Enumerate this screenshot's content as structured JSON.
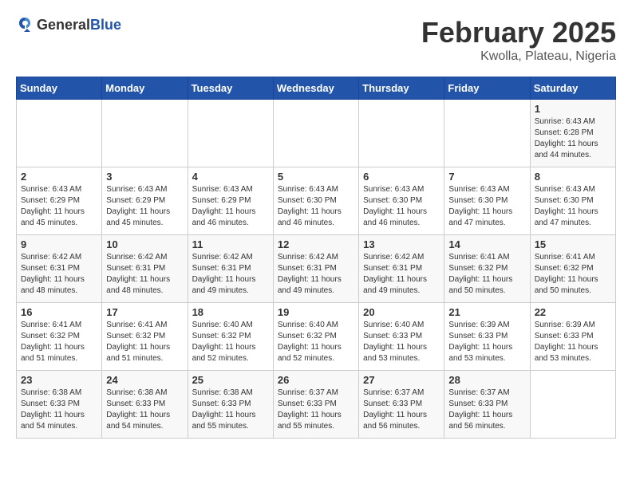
{
  "header": {
    "logo_general": "General",
    "logo_blue": "Blue",
    "title": "February 2025",
    "subtitle": "Kwolla, Plateau, Nigeria"
  },
  "weekdays": [
    "Sunday",
    "Monday",
    "Tuesday",
    "Wednesday",
    "Thursday",
    "Friday",
    "Saturday"
  ],
  "weeks": [
    [
      {
        "day": "",
        "info": ""
      },
      {
        "day": "",
        "info": ""
      },
      {
        "day": "",
        "info": ""
      },
      {
        "day": "",
        "info": ""
      },
      {
        "day": "",
        "info": ""
      },
      {
        "day": "",
        "info": ""
      },
      {
        "day": "1",
        "info": "Sunrise: 6:43 AM\nSunset: 6:28 PM\nDaylight: 11 hours and 44 minutes."
      }
    ],
    [
      {
        "day": "2",
        "info": "Sunrise: 6:43 AM\nSunset: 6:29 PM\nDaylight: 11 hours and 45 minutes."
      },
      {
        "day": "3",
        "info": "Sunrise: 6:43 AM\nSunset: 6:29 PM\nDaylight: 11 hours and 45 minutes."
      },
      {
        "day": "4",
        "info": "Sunrise: 6:43 AM\nSunset: 6:29 PM\nDaylight: 11 hours and 46 minutes."
      },
      {
        "day": "5",
        "info": "Sunrise: 6:43 AM\nSunset: 6:30 PM\nDaylight: 11 hours and 46 minutes."
      },
      {
        "day": "6",
        "info": "Sunrise: 6:43 AM\nSunset: 6:30 PM\nDaylight: 11 hours and 46 minutes."
      },
      {
        "day": "7",
        "info": "Sunrise: 6:43 AM\nSunset: 6:30 PM\nDaylight: 11 hours and 47 minutes."
      },
      {
        "day": "8",
        "info": "Sunrise: 6:43 AM\nSunset: 6:30 PM\nDaylight: 11 hours and 47 minutes."
      }
    ],
    [
      {
        "day": "9",
        "info": "Sunrise: 6:42 AM\nSunset: 6:31 PM\nDaylight: 11 hours and 48 minutes."
      },
      {
        "day": "10",
        "info": "Sunrise: 6:42 AM\nSunset: 6:31 PM\nDaylight: 11 hours and 48 minutes."
      },
      {
        "day": "11",
        "info": "Sunrise: 6:42 AM\nSunset: 6:31 PM\nDaylight: 11 hours and 49 minutes."
      },
      {
        "day": "12",
        "info": "Sunrise: 6:42 AM\nSunset: 6:31 PM\nDaylight: 11 hours and 49 minutes."
      },
      {
        "day": "13",
        "info": "Sunrise: 6:42 AM\nSunset: 6:31 PM\nDaylight: 11 hours and 49 minutes."
      },
      {
        "day": "14",
        "info": "Sunrise: 6:41 AM\nSunset: 6:32 PM\nDaylight: 11 hours and 50 minutes."
      },
      {
        "day": "15",
        "info": "Sunrise: 6:41 AM\nSunset: 6:32 PM\nDaylight: 11 hours and 50 minutes."
      }
    ],
    [
      {
        "day": "16",
        "info": "Sunrise: 6:41 AM\nSunset: 6:32 PM\nDaylight: 11 hours and 51 minutes."
      },
      {
        "day": "17",
        "info": "Sunrise: 6:41 AM\nSunset: 6:32 PM\nDaylight: 11 hours and 51 minutes."
      },
      {
        "day": "18",
        "info": "Sunrise: 6:40 AM\nSunset: 6:32 PM\nDaylight: 11 hours and 52 minutes."
      },
      {
        "day": "19",
        "info": "Sunrise: 6:40 AM\nSunset: 6:32 PM\nDaylight: 11 hours and 52 minutes."
      },
      {
        "day": "20",
        "info": "Sunrise: 6:40 AM\nSunset: 6:33 PM\nDaylight: 11 hours and 53 minutes."
      },
      {
        "day": "21",
        "info": "Sunrise: 6:39 AM\nSunset: 6:33 PM\nDaylight: 11 hours and 53 minutes."
      },
      {
        "day": "22",
        "info": "Sunrise: 6:39 AM\nSunset: 6:33 PM\nDaylight: 11 hours and 53 minutes."
      }
    ],
    [
      {
        "day": "23",
        "info": "Sunrise: 6:38 AM\nSunset: 6:33 PM\nDaylight: 11 hours and 54 minutes."
      },
      {
        "day": "24",
        "info": "Sunrise: 6:38 AM\nSunset: 6:33 PM\nDaylight: 11 hours and 54 minutes."
      },
      {
        "day": "25",
        "info": "Sunrise: 6:38 AM\nSunset: 6:33 PM\nDaylight: 11 hours and 55 minutes."
      },
      {
        "day": "26",
        "info": "Sunrise: 6:37 AM\nSunset: 6:33 PM\nDaylight: 11 hours and 55 minutes."
      },
      {
        "day": "27",
        "info": "Sunrise: 6:37 AM\nSunset: 6:33 PM\nDaylight: 11 hours and 56 minutes."
      },
      {
        "day": "28",
        "info": "Sunrise: 6:37 AM\nSunset: 6:33 PM\nDaylight: 11 hours and 56 minutes."
      },
      {
        "day": "",
        "info": ""
      }
    ]
  ]
}
